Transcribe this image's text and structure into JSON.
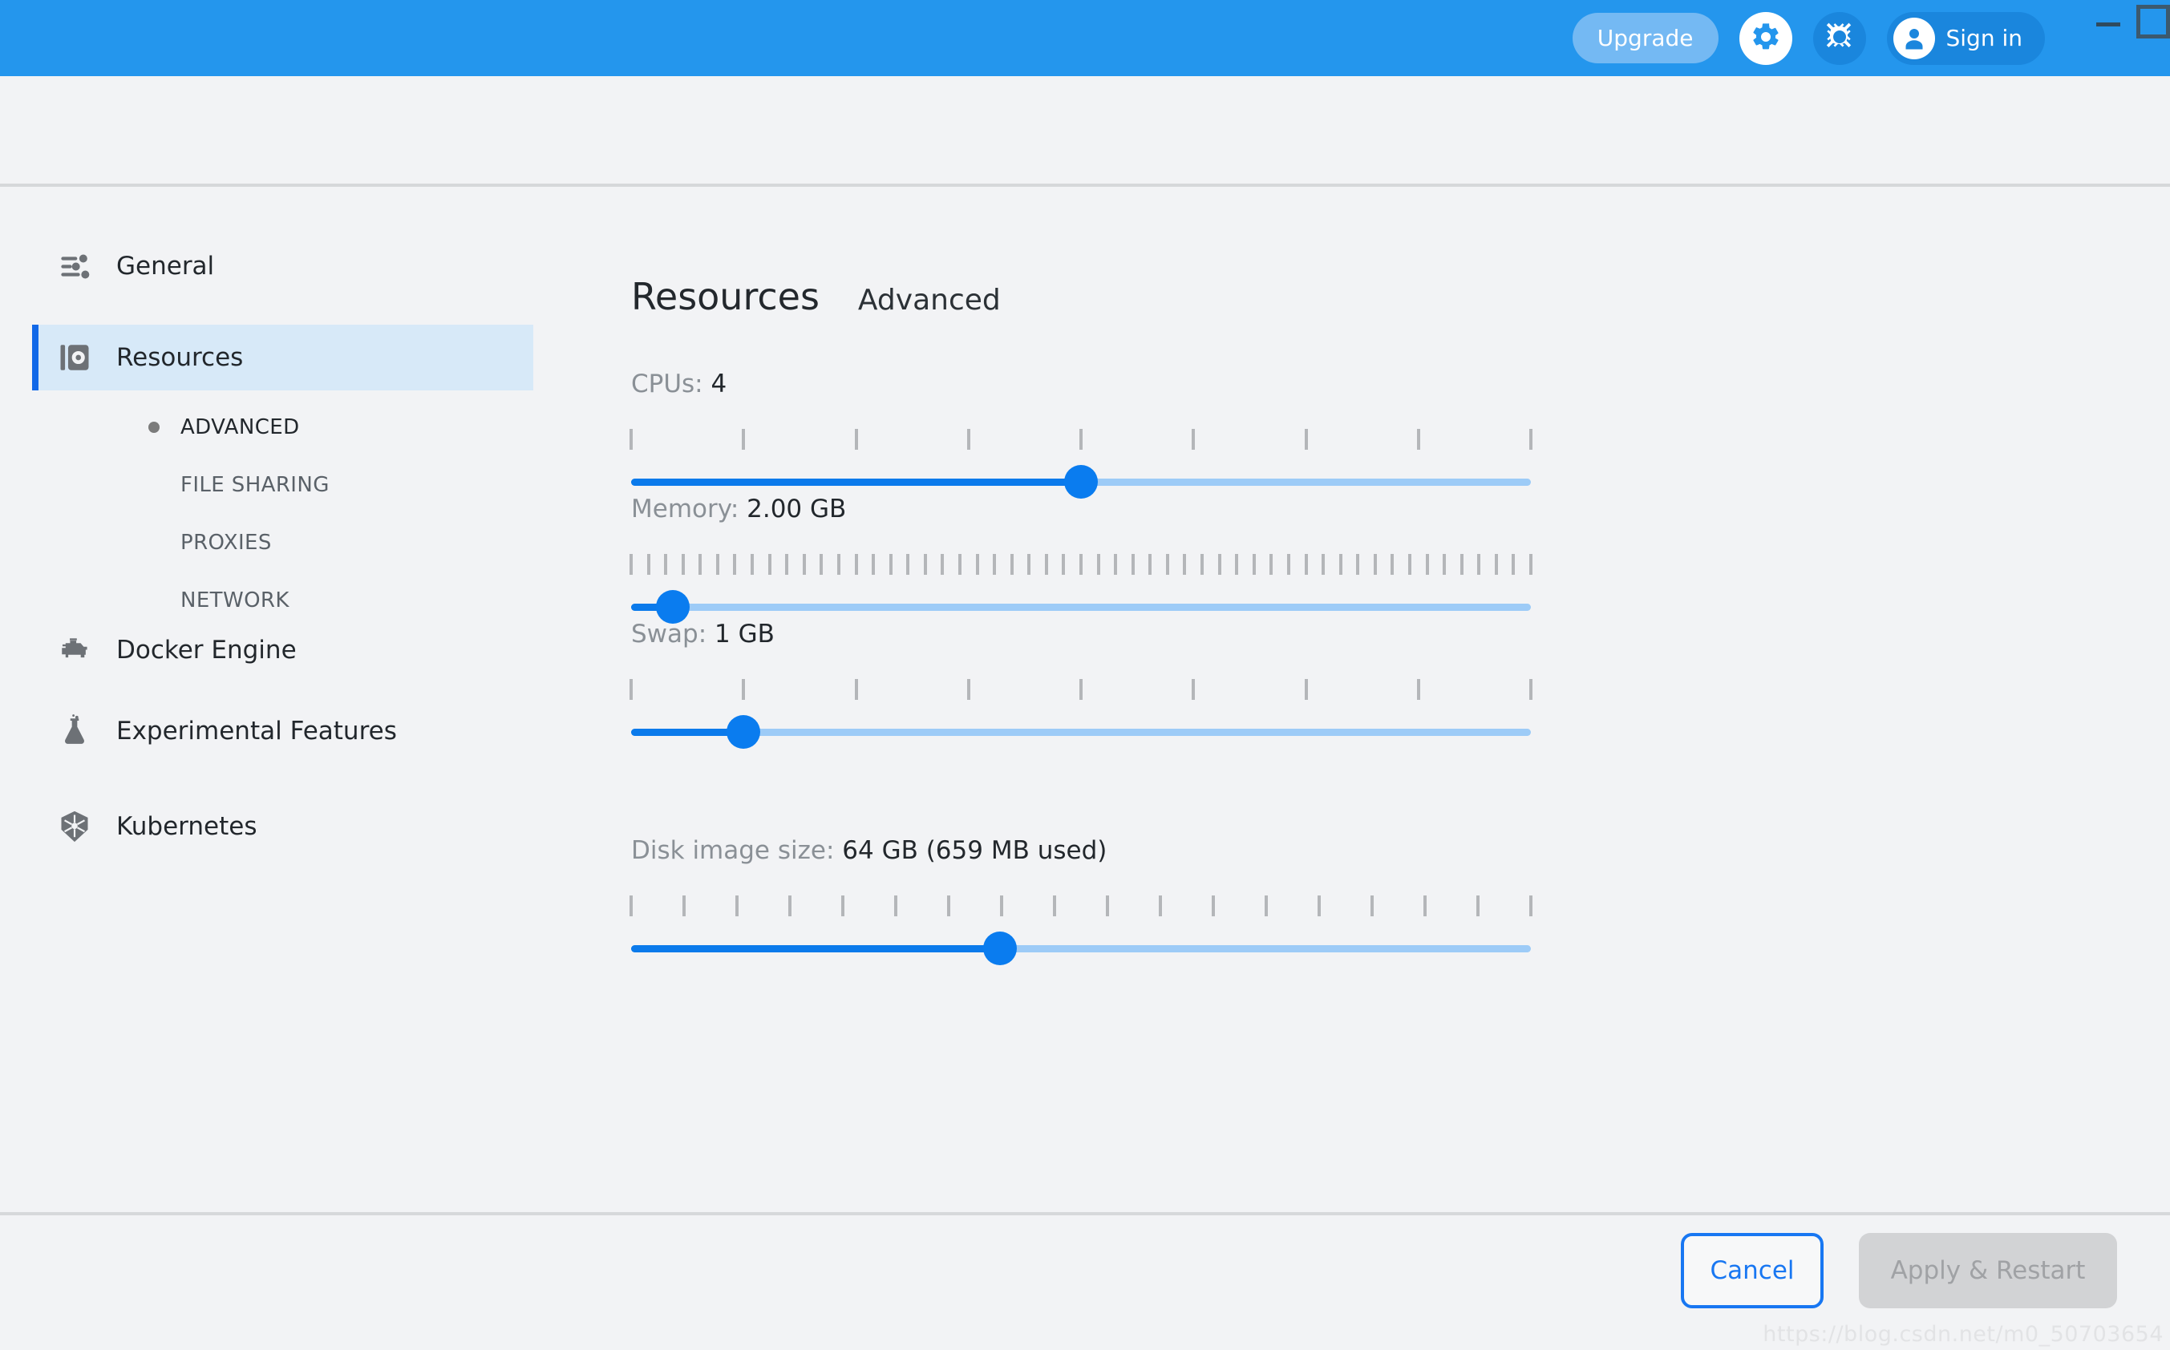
{
  "titlebar": {
    "background_color": "#2496ed",
    "upgrade_label": "Upgrade",
    "settings_icon": "gear-icon",
    "bug_icon": "bug-icon",
    "signin_label": "Sign in",
    "avatar_icon": "user-avatar-icon",
    "minimize_label": "minimize-icon",
    "maximize_label": "maximize-icon"
  },
  "sidebar": {
    "items": [
      {
        "label": "General",
        "icon": "sliders-icon",
        "active": false
      },
      {
        "label": "Resources",
        "icon": "resources-icon",
        "active": true
      },
      {
        "label": "Docker Engine",
        "icon": "engine-icon",
        "active": false
      },
      {
        "label": "Experimental Features",
        "icon": "flask-icon",
        "active": false
      },
      {
        "label": "Kubernetes",
        "icon": "kubernetes-helm-icon",
        "active": false
      }
    ],
    "subitems": [
      {
        "label": "ADVANCED",
        "current": true
      },
      {
        "label": "FILE SHARING",
        "current": false
      },
      {
        "label": "PROXIES",
        "current": false
      },
      {
        "label": "NETWORK",
        "current": false
      }
    ]
  },
  "main": {
    "title": "Resources",
    "subtitle": "Advanced",
    "sliders": [
      {
        "name": "cpus",
        "label_prefix": "CPUs: ",
        "value_text": "4",
        "percent": 50,
        "tick_count": 9
      },
      {
        "name": "memory",
        "label_prefix": "Memory: ",
        "value_text": "2.00 GB",
        "percent": 4.6,
        "tick_count": 53
      },
      {
        "name": "swap",
        "label_prefix": "Swap: ",
        "value_text": "1 GB",
        "percent": 12.5,
        "tick_count": 9
      },
      {
        "name": "disk-image-size",
        "label_prefix": "Disk image size: ",
        "value_text": "64 GB (659 MB used)",
        "percent": 41,
        "tick_count": 18
      }
    ]
  },
  "footer": {
    "cancel_label": "Cancel",
    "apply_label": "Apply & Restart"
  },
  "watermark": {
    "text": "https://blog.csdn.net/m0_50703654"
  },
  "colors": {
    "brand_blue": "#2496ed",
    "accent_blue": "#0a7cef",
    "active_nav_bg": "#d7e9f8",
    "page_bg": "#f2f3f5"
  }
}
